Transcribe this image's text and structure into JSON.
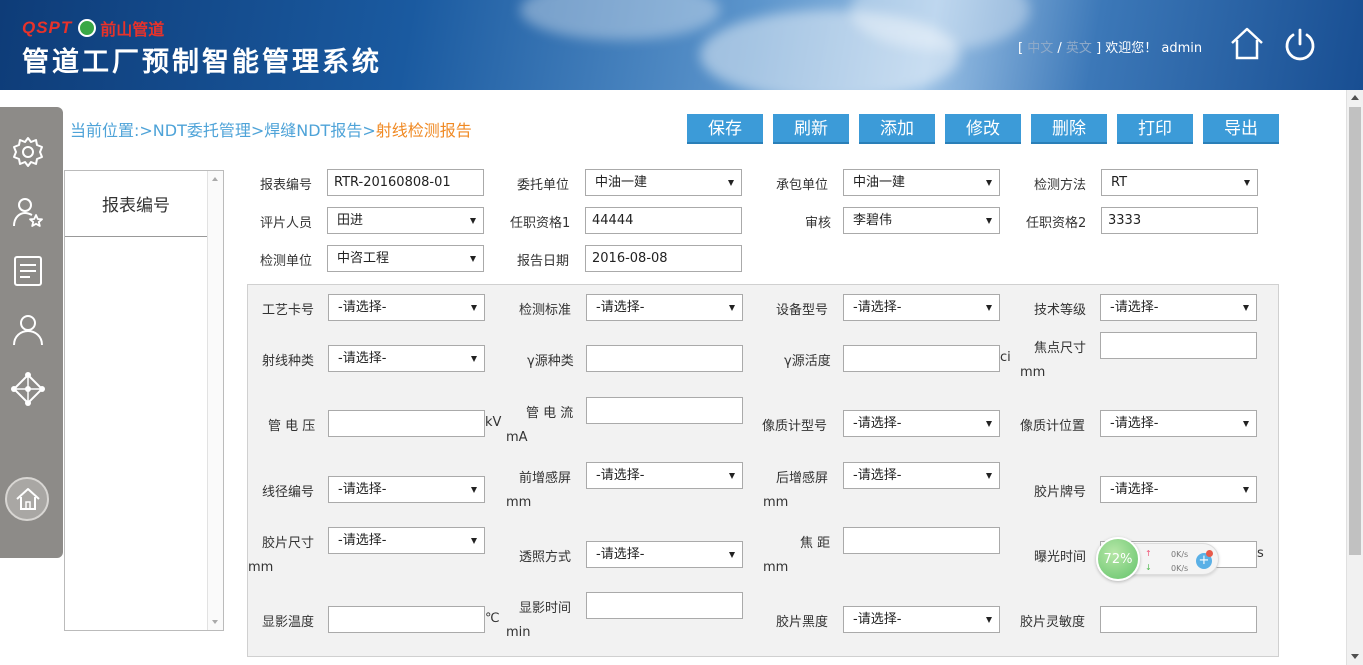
{
  "header": {
    "brand_code": "QSPT",
    "brand_name": "前山管道",
    "system_title": "管道工厂预制智能管理系统",
    "lang_open": "[",
    "lang_cn": "中文",
    "lang_sep": "/",
    "lang_en": "英文",
    "welcome": "] 欢迎您！ admin"
  },
  "sidebar": {
    "icons": [
      "gear-icon",
      "user-star-icon",
      "document-icon",
      "user-icon",
      "network-icon",
      "home-icon"
    ]
  },
  "left_panel": {
    "header": "报表编号"
  },
  "breadcrumb": {
    "prefix": "当前位置:>NDT委托管理>焊缝NDT报告>",
    "current": "射线检测报告"
  },
  "toolbar": {
    "save": "保存",
    "refresh": "刷新",
    "add": "添加",
    "edit": "修改",
    "delete": "删除",
    "print": "打印",
    "export": "导出"
  },
  "form": {
    "report_no_label": "报表编号",
    "report_no": "RTR-20160808-01",
    "client_label": "委托单位",
    "client": "中油一建",
    "contractor_label": "承包单位",
    "contractor": "中油一建",
    "method_label": "检测方法",
    "method": "RT",
    "reviewer_label": "评片人员",
    "reviewer": "田进",
    "qual1_label": "任职资格1",
    "qual1": "44444",
    "audit_label": "审核",
    "audit": "李碧伟",
    "qual2_label": "任职资格2",
    "qual2": "3333",
    "inspect_unit_label": "检测单位",
    "inspect_unit": "中咨工程",
    "report_date_label": "报告日期",
    "report_date": "2016-08-08"
  },
  "params": {
    "placeholder": "-请选择-",
    "craft_card": "工艺卡号",
    "standard": "检测标准",
    "device_model": "设备型号",
    "tech_level": "技术等级",
    "ray_type": "射线种类",
    "gamma_type": "γ源种类",
    "gamma_activity": "γ源活度",
    "gamma_unit": "ci",
    "focus_size": "焦点尺寸",
    "mm": "mm",
    "tube_voltage": "管 电 压",
    "kv": "kV",
    "tube_current": "管 电 流",
    "ma": "mA",
    "iqi_model": "像质计型号",
    "iqi_position": "像质计位置",
    "wire_no": "线径编号",
    "front_screen": "前增感屏",
    "back_screen": "后增感屏",
    "film_brand": "胶片牌号",
    "film_size": "胶片尺寸",
    "transillum": "透照方式",
    "focal_dist": "焦 距",
    "exposure_time": "曝光时间",
    "s": "s",
    "dev_temp": "显影温度",
    "celsius": "℃",
    "dev_time": "显影时间",
    "min": "min",
    "film_density": "胶片黑度",
    "film_sensitivity": "胶片灵敏度"
  },
  "net_widget": {
    "percent": "72%",
    "up": "0K/s",
    "down": "0K/s"
  }
}
